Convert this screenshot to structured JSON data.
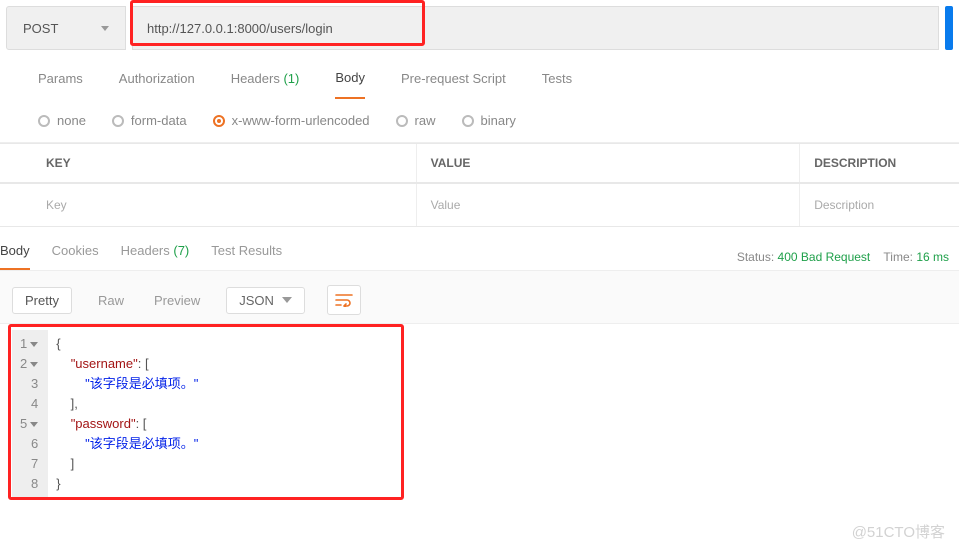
{
  "request": {
    "method": "POST",
    "url": "http://127.0.0.1:8000/users/login"
  },
  "tabs_req": {
    "params": "Params",
    "auth": "Authorization",
    "headers": "Headers",
    "headers_count": "(1)",
    "body": "Body",
    "prereq": "Pre-request Script",
    "tests": "Tests"
  },
  "body_types": {
    "none": "none",
    "form": "form-data",
    "xwww": "x-www-form-urlencoded",
    "raw": "raw",
    "binary": "binary"
  },
  "kv": {
    "key_h": "KEY",
    "val_h": "VALUE",
    "desc_h": "DESCRIPTION",
    "key_p": "Key",
    "val_p": "Value",
    "desc_p": "Description"
  },
  "tabs_resp": {
    "body": "Body",
    "cookies": "Cookies",
    "headers": "Headers",
    "headers_count": "(7)",
    "tests": "Test Results"
  },
  "status": {
    "label": "Status:",
    "value": "400 Bad Request",
    "time_label": "Time:",
    "time_value": "16 ms"
  },
  "view": {
    "pretty": "Pretty",
    "raw": "Raw",
    "preview": "Preview",
    "format": "JSON"
  },
  "response_json": {
    "key1": "\"username\"",
    "key2": "\"password\"",
    "msg": "\"该字段是必填项。\""
  },
  "watermark": "@51CTO博客"
}
